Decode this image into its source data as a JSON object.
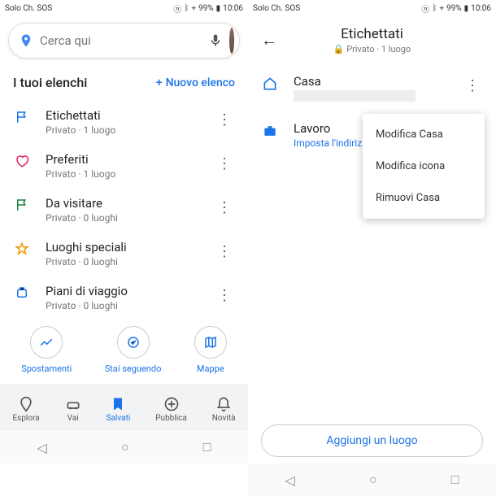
{
  "status": {
    "left": "Solo Ch. SOS",
    "battery": "99%",
    "time": "10:06"
  },
  "screen1": {
    "search_placeholder": "Cerca qui",
    "section_title": "I tuoi elenchi",
    "new_list": "Nuovo elenco",
    "lists": [
      {
        "title": "Etichettati",
        "sub": "Privato · 1 luogo"
      },
      {
        "title": "Preferiti",
        "sub": "Privato · 1 luogo"
      },
      {
        "title": "Da visitare",
        "sub": "Privato · 0 luoghi"
      },
      {
        "title": "Luoghi speciali",
        "sub": "Privato · 0 luoghi"
      },
      {
        "title": "Piani di viaggio",
        "sub": "Privato · 0 luoghi"
      }
    ],
    "chips": [
      {
        "label": "Spostamenti"
      },
      {
        "label": "Stai seguendo"
      },
      {
        "label": "Mappe"
      }
    ],
    "nav": [
      {
        "label": "Esplora"
      },
      {
        "label": "Vai"
      },
      {
        "label": "Salvati"
      },
      {
        "label": "Pubblica"
      },
      {
        "label": "Novità"
      }
    ]
  },
  "screen2": {
    "title": "Etichettati",
    "subtitle": "Privato · 1 luogo",
    "items": [
      {
        "title": "Casa"
      },
      {
        "title": "Lavoro",
        "sub": "Imposta l'indirizzo di lavo"
      }
    ],
    "popup": [
      "Modifica Casa",
      "Modifica icona",
      "Rimuovi Casa"
    ],
    "add_place": "Aggiungi un luogo"
  }
}
